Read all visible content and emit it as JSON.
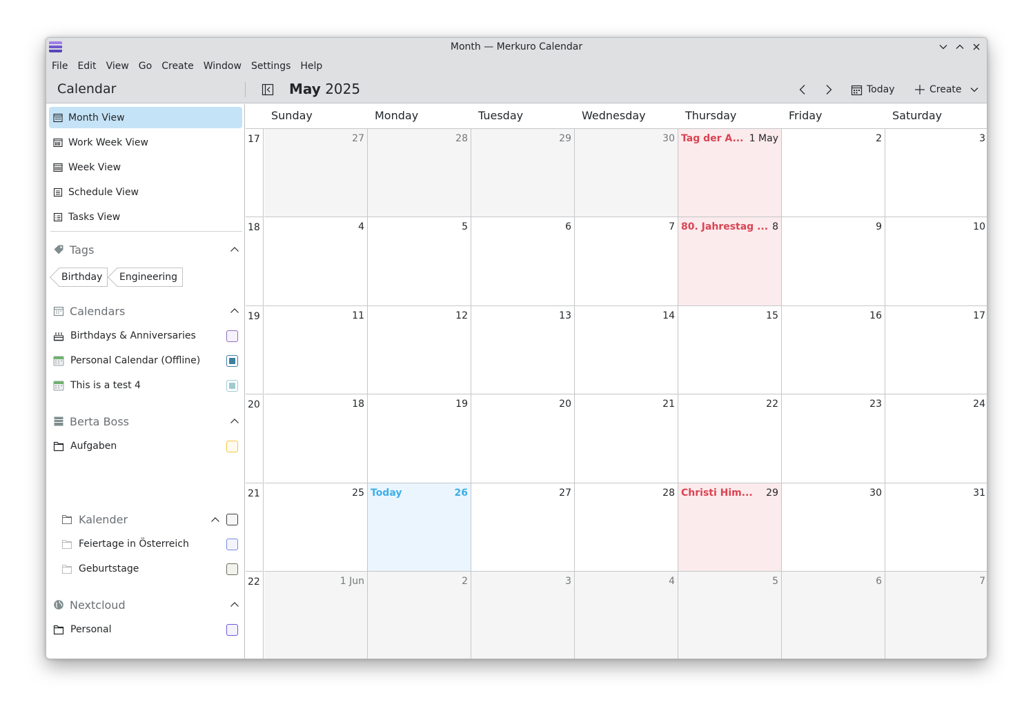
{
  "window": {
    "title": "Month — Merkuro Calendar"
  },
  "menu": [
    "File",
    "Edit",
    "View",
    "Go",
    "Create",
    "Window",
    "Settings",
    "Help"
  ],
  "header": {
    "sidebar_title": "Calendar",
    "month": "May",
    "year": "2025",
    "today_label": "Today",
    "create_label": "Create"
  },
  "views": [
    {
      "label": "Month View",
      "icon": "month-view-icon",
      "active": true
    },
    {
      "label": "Work Week View",
      "icon": "work-week-view-icon",
      "active": false
    },
    {
      "label": "Week View",
      "icon": "week-view-icon",
      "active": false
    },
    {
      "label": "Schedule View",
      "icon": "schedule-view-icon",
      "active": false
    },
    {
      "label": "Tasks View",
      "icon": "tasks-view-icon",
      "active": false
    }
  ],
  "tags": {
    "title": "Tags",
    "items": [
      "Birthday",
      "Engineering"
    ]
  },
  "calendars": {
    "title": "Calendars",
    "items": [
      {
        "label": "Birthdays & Anniversaries",
        "color": "#8d6bc0",
        "checked": false
      },
      {
        "label": "Personal Calendar (Offline)",
        "color": "#3d7fa0",
        "checked": true
      },
      {
        "label": "This is a test 4",
        "color": "#9fcbd0",
        "checked": true
      }
    ]
  },
  "berta": {
    "title": "Berta Boss",
    "items": [
      {
        "label": "Aufgaben",
        "color": "#f5c842",
        "checked": false
      }
    ],
    "kalender": {
      "label": "Kalender",
      "color": "#3b3f43",
      "children": [
        {
          "label": "Feiertage in Österreich",
          "color": "#7a8ae0",
          "checked": false
        },
        {
          "label": "Geburtstage",
          "color": "#6a6e5a",
          "checked": false
        }
      ]
    }
  },
  "nextcloud": {
    "title": "Nextcloud",
    "items": [
      {
        "label": "Personal",
        "color": "#6b58d8",
        "checked": false
      }
    ]
  },
  "month_grid": {
    "weekdays": [
      "Sunday",
      "Monday",
      "Tuesday",
      "Wednesday",
      "Thursday",
      "Friday",
      "Saturday"
    ],
    "weeks": [
      {
        "num": "17",
        "days": [
          {
            "label": "27",
            "other": true
          },
          {
            "label": "28",
            "other": true
          },
          {
            "label": "29",
            "other": true
          },
          {
            "label": "30",
            "other": true
          },
          {
            "label": "1 May",
            "holiday": "Tag der A..."
          },
          {
            "label": "2"
          },
          {
            "label": "3"
          }
        ]
      },
      {
        "num": "18",
        "days": [
          {
            "label": "4"
          },
          {
            "label": "5"
          },
          {
            "label": "6"
          },
          {
            "label": "7"
          },
          {
            "label": "8",
            "holiday": "80. Jahrestag ..."
          },
          {
            "label": "9"
          },
          {
            "label": "10"
          }
        ]
      },
      {
        "num": "19",
        "days": [
          {
            "label": "11"
          },
          {
            "label": "12"
          },
          {
            "label": "13"
          },
          {
            "label": "14"
          },
          {
            "label": "15"
          },
          {
            "label": "16"
          },
          {
            "label": "17"
          }
        ]
      },
      {
        "num": "20",
        "days": [
          {
            "label": "18"
          },
          {
            "label": "19"
          },
          {
            "label": "20"
          },
          {
            "label": "21"
          },
          {
            "label": "22"
          },
          {
            "label": "23"
          },
          {
            "label": "24"
          }
        ]
      },
      {
        "num": "21",
        "days": [
          {
            "label": "25"
          },
          {
            "label": "26",
            "today": "Today"
          },
          {
            "label": "27"
          },
          {
            "label": "28"
          },
          {
            "label": "29",
            "holiday": "Christi Him..."
          },
          {
            "label": "30"
          },
          {
            "label": "31"
          }
        ]
      },
      {
        "num": "22",
        "days": [
          {
            "label": "1 Jun",
            "other": true
          },
          {
            "label": "2",
            "other": true
          },
          {
            "label": "3",
            "other": true
          },
          {
            "label": "4",
            "other": true
          },
          {
            "label": "5",
            "other": true
          },
          {
            "label": "6",
            "other": true
          },
          {
            "label": "7",
            "other": true
          }
        ]
      }
    ]
  }
}
